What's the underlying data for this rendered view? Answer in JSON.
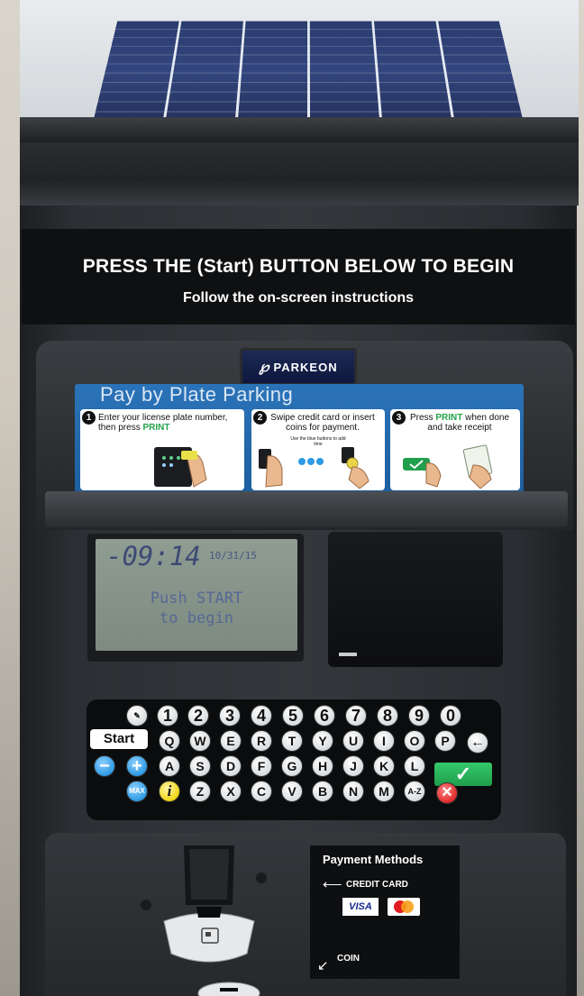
{
  "sign": {
    "title": "PRESS THE (Start) BUTTON BELOW TO BEGIN",
    "subtitle": "Follow the on-screen instructions"
  },
  "brand": {
    "name": "PARKEON"
  },
  "panel": {
    "title": "Pay by Plate Parking",
    "steps": [
      {
        "num": "1",
        "text_a": "Enter your license plate number, then press ",
        "highlight": "PRINT",
        "text_b": ""
      },
      {
        "num": "2",
        "text_a": "Swipe credit card or insert coins for payment.",
        "highlight": "",
        "text_b": "Use the blue buttons to add time"
      },
      {
        "num": "3",
        "text_a": "Press ",
        "highlight": "PRINT",
        "text_b": " when done and take receipt"
      }
    ]
  },
  "display": {
    "time": "-09:14",
    "date": "10/31/15",
    "line1": "Push START",
    "line2": "to begin"
  },
  "keypad": {
    "numbers": [
      "1",
      "2",
      "3",
      "4",
      "5",
      "6",
      "7",
      "8",
      "9",
      "0"
    ],
    "row_q": [
      "Q",
      "W",
      "E",
      "R",
      "T",
      "Y",
      "U",
      "I",
      "O",
      "P"
    ],
    "row_a": [
      "A",
      "S",
      "D",
      "F",
      "G",
      "H",
      "J",
      "K",
      "L"
    ],
    "row_z": [
      "Z",
      "X",
      "C",
      "V",
      "B",
      "N",
      "M"
    ],
    "start": "Start",
    "minus": "−",
    "plus": "+",
    "max": "MAX",
    "info": "i",
    "az": "A-Z",
    "backspace": "←",
    "ok": "✓",
    "cancel": "✕"
  },
  "payment": {
    "title": "Payment Methods",
    "credit": "CREDIT CARD",
    "visa": "VISA",
    "coin": "COIN"
  },
  "colors": {
    "panel_blue": "#2b73b8",
    "print_green": "#23a24a",
    "ok_green": "#1f9e4c",
    "key_blue": "#2d9ae4",
    "info_yellow": "#f0d514",
    "cancel_red": "#e12b2b"
  }
}
